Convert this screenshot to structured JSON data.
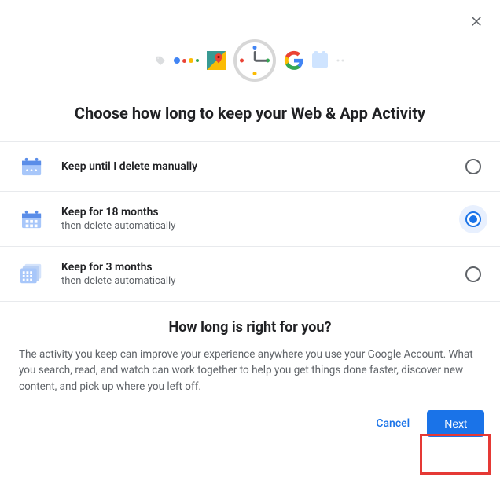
{
  "close_label": "Close",
  "title": "Choose how long to keep your Web & App Activity",
  "options": [
    {
      "label": "Keep until I delete manually",
      "sub": "",
      "selected": false,
      "name": "option-keep-manual"
    },
    {
      "label": "Keep for 18 months",
      "sub": "then delete automatically",
      "selected": true,
      "name": "option-keep-18m"
    },
    {
      "label": "Keep for 3 months",
      "sub": "then delete automatically",
      "selected": false,
      "name": "option-keep-3m"
    }
  ],
  "help": {
    "title": "How long is right for you?",
    "body": "The activity you keep can improve your experience anywhere you use your Google Account. What you search, read, and watch can work together to help you get things done faster, discover new content, and pick up where you left off."
  },
  "actions": {
    "cancel": "Cancel",
    "next": "Next"
  }
}
